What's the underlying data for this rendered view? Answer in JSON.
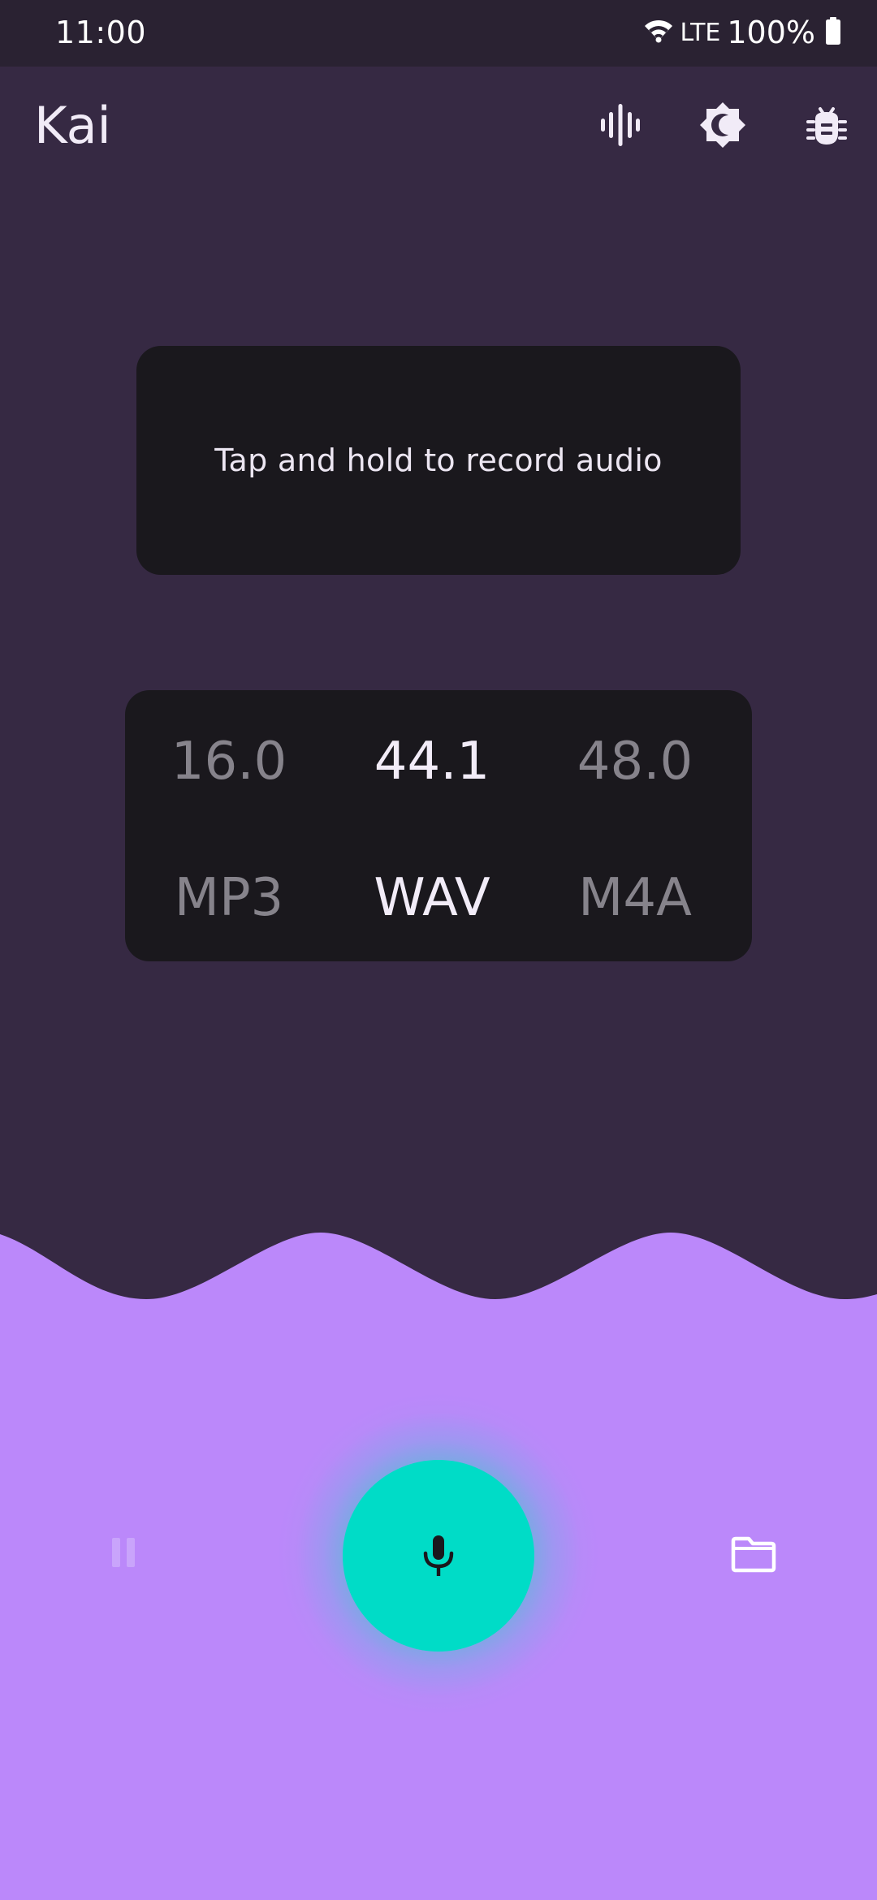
{
  "status_bar": {
    "time": "11:00",
    "network": "LTE",
    "battery": "100%"
  },
  "app_bar": {
    "title": "Kai",
    "actions": [
      "waveform-icon",
      "brightness-icon",
      "bug-icon"
    ]
  },
  "hint": {
    "text": "Tap and hold to record audio"
  },
  "sample_rates": {
    "options": [
      "16.0",
      "44.1",
      "48.0"
    ],
    "selected": "44.1"
  },
  "formats": {
    "options": [
      "MP3",
      "WAV",
      "M4A"
    ],
    "selected": "WAV"
  },
  "controls": {
    "pause_enabled": false,
    "record_icon": "mic-icon",
    "files_icon": "folder-icon"
  },
  "colors": {
    "background": "#362943",
    "status_bar": "#2a2232",
    "card": "#1a181d",
    "wave_panel": "#bb88fa",
    "record_button": "#00dcc7",
    "record_glow": "#7ca8e4",
    "selected_text": "#f2ecf8",
    "unselected_text": "#86838b"
  }
}
